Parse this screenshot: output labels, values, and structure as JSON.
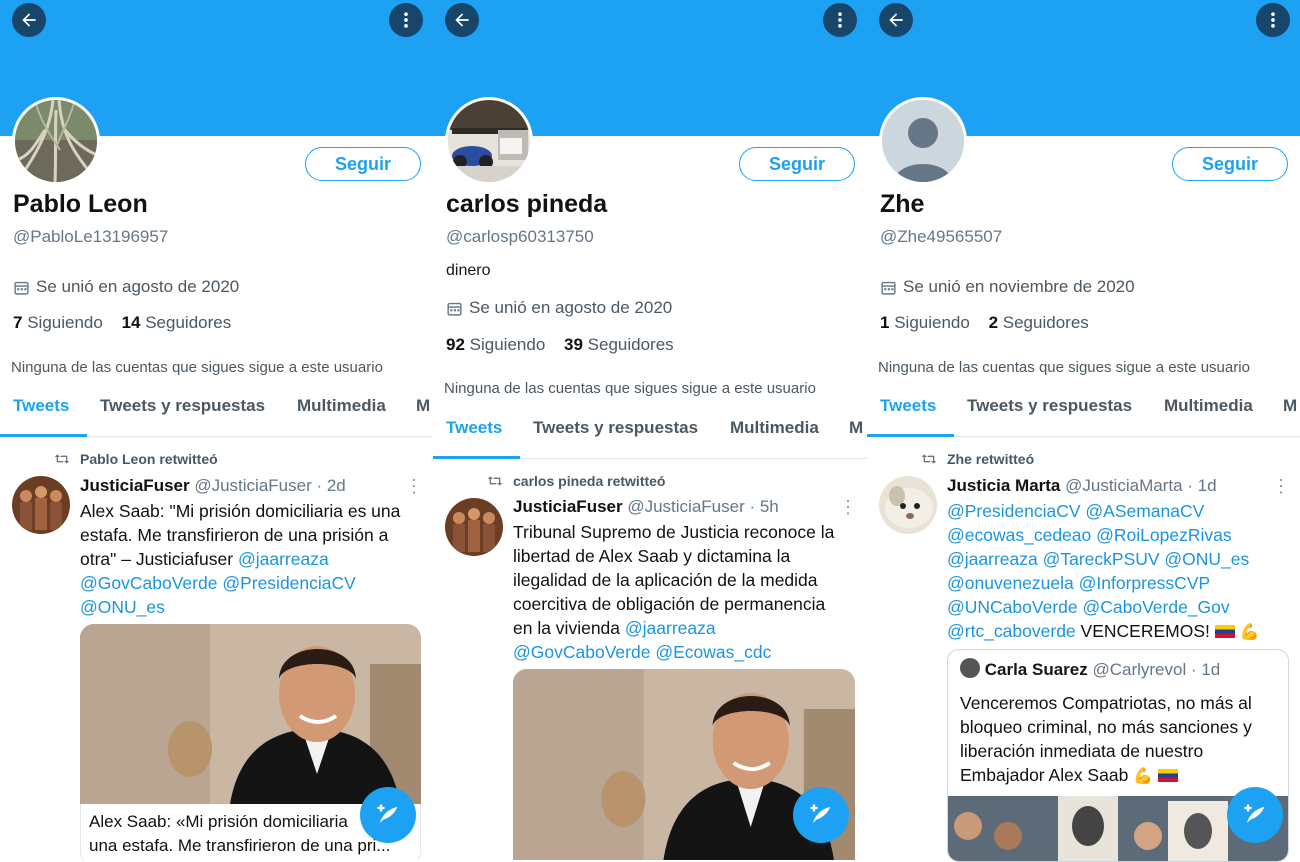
{
  "profiles": [
    {
      "name": "Pablo Leon",
      "handle": "@PabloLe13196957",
      "bio": "",
      "joined": "Se unió en agosto de 2020",
      "following_count": "7",
      "following_label": "Siguiendo",
      "followers_count": "14",
      "followers_label": "Seguidores",
      "follow_button": "Seguir",
      "note": "Ninguna de las cuentas que sigues sigue a este usuario",
      "tabs": [
        "Tweets",
        "Tweets y respuestas",
        "Multimedia",
        "M"
      ],
      "retweet_label": "Pablo Leon retwitteó",
      "tweet": {
        "author": "JusticiaFuser",
        "meta": "@JusticiaFuser · 2d",
        "text_lines": [
          "Alex Saab: \"Mi prisión domiciliaria es una",
          "estafa. Me transfirieron de una prisión a",
          "otra\" – Justiciafuser"
        ],
        "mention_1": "@jaarreaza",
        "mention_2": "@GovCaboVerde",
        "mention_3": "@PresidenciaCV",
        "mention_4": "@ONU_es",
        "card_line_1": "Alex Saab: «Mi prisión domiciliaria",
        "card_line_2": "una estafa. Me transfirieron de una pri..."
      }
    },
    {
      "name": "carlos pineda",
      "handle": "@carlosp60313750",
      "bio": "dinero",
      "joined": "Se unió en agosto de 2020",
      "following_count": "92",
      "following_label": "Siguiendo",
      "followers_count": "39",
      "followers_label": "Seguidores",
      "follow_button": "Seguir",
      "note": "Ninguna de las cuentas que sigues sigue a este usuario",
      "tabs": [
        "Tweets",
        "Tweets y respuestas",
        "Multimedia",
        "M"
      ],
      "retweet_label": "carlos pineda retwitteó",
      "tweet": {
        "author": "JusticiaFuser",
        "meta": "@JusticiaFuser · 5h",
        "text_lines": [
          "Tribunal Supremo de Justicia reconoce la",
          "libertad de Alex Saab y dictamina la",
          "ilegalidad de la aplicación de la medida",
          "coercitiva de obligación de permanencia",
          "en la vivienda"
        ],
        "mention_1": "@jaarreaza",
        "mention_2": "@GovCaboVerde",
        "mention_3": "@Ecowas_cdc"
      }
    },
    {
      "name": "Zhe",
      "handle": "@Zhe49565507",
      "bio": "",
      "joined": "Se unió en noviembre de 2020",
      "following_count": "1",
      "following_label": "Siguiendo",
      "followers_count": "2",
      "followers_label": "Seguidores",
      "follow_button": "Seguir",
      "note": "Ninguna de las cuentas que sigues sigue a este usuario",
      "tabs": [
        "Tweets",
        "Tweets y respuestas",
        "Multimedia",
        "M"
      ],
      "retweet_label": "Zhe retwitteó",
      "tweet": {
        "author": "Justicia Marta",
        "meta": "@JusticiaMarta · 1d",
        "mention_lines": [
          "@PresidenciaCV @ASemanaCV",
          "@ecowas_cedeao @RoiLopezRivas",
          "@jaarreaza @TareckPSUV @ONU_es",
          "@onuvenezuela @InforpressCVP",
          "@UNCaboVerde @CaboVerde_Gov"
        ],
        "last_mention": "@rtc_caboverde",
        "last_text": "VENCEREMOS!",
        "quote": {
          "author": "Carla Suarez",
          "meta": "@Carlyrevol · 1d",
          "text_lines": [
            "Venceremos Compatriotas, no más al",
            "bloqueo criminal, no más sanciones y",
            "liberación inmediata de nuestro",
            "Embajador Alex Saab"
          ]
        }
      }
    }
  ],
  "colors": {
    "accent": "#1da1f2",
    "banner": "#1da1f2",
    "link": "#1b95e0",
    "muted": "#657786"
  },
  "icons": [
    "back-arrow-icon",
    "more-vertical-icon",
    "calendar-icon",
    "retweet-icon",
    "compose-tweet-icon"
  ]
}
